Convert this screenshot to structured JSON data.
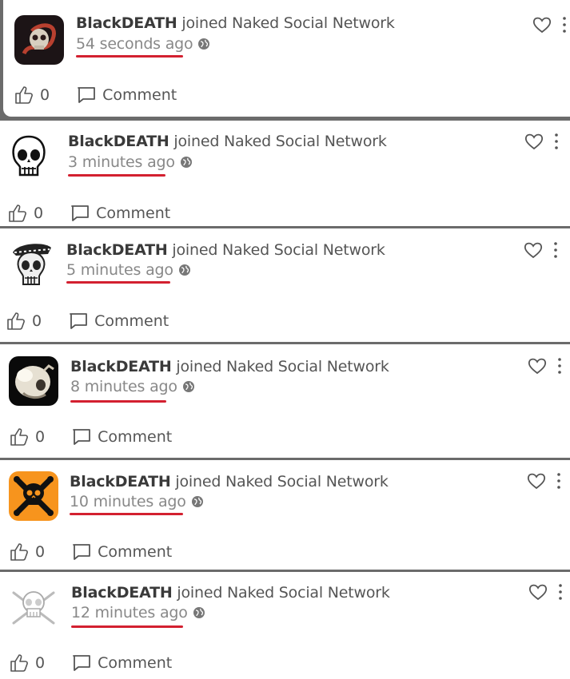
{
  "feed": {
    "posts": [
      {
        "user": "BlackDEATH",
        "action": " joined Naked Social Network",
        "time": "54 seconds ago",
        "likes": "0",
        "comment_label": "Comment",
        "avatar_icon": "snake-skull-avatar"
      },
      {
        "user": "BlackDEATH",
        "action": " joined Naked Social Network",
        "time": "3 minutes ago",
        "likes": "0",
        "comment_label": "Comment",
        "avatar_icon": "cartoon-skull-avatar"
      },
      {
        "user": "BlackDEATH",
        "action": " joined Naked Social Network",
        "time": "5 minutes ago",
        "likes": "0",
        "comment_label": "Comment",
        "avatar_icon": "skull-with-hat-avatar"
      },
      {
        "user": "BlackDEATH",
        "action": " joined Naked Social Network",
        "time": "8 minutes ago",
        "likes": "0",
        "comment_label": "Comment",
        "avatar_icon": "skull-photo-avatar"
      },
      {
        "user": "BlackDEATH",
        "action": " joined Naked Social Network",
        "time": "10 minutes ago",
        "likes": "0",
        "comment_label": "Comment",
        "avatar_icon": "toxic-hazard-skull-avatar"
      },
      {
        "user": "BlackDEATH",
        "action": " joined Naked Social Network",
        "time": "12 minutes ago",
        "likes": "0",
        "comment_label": "Comment",
        "avatar_icon": "skull-crossbones-sketch-avatar"
      }
    ]
  },
  "colors": {
    "underline": "#d32030",
    "text": "#555555",
    "muted": "#888888"
  }
}
